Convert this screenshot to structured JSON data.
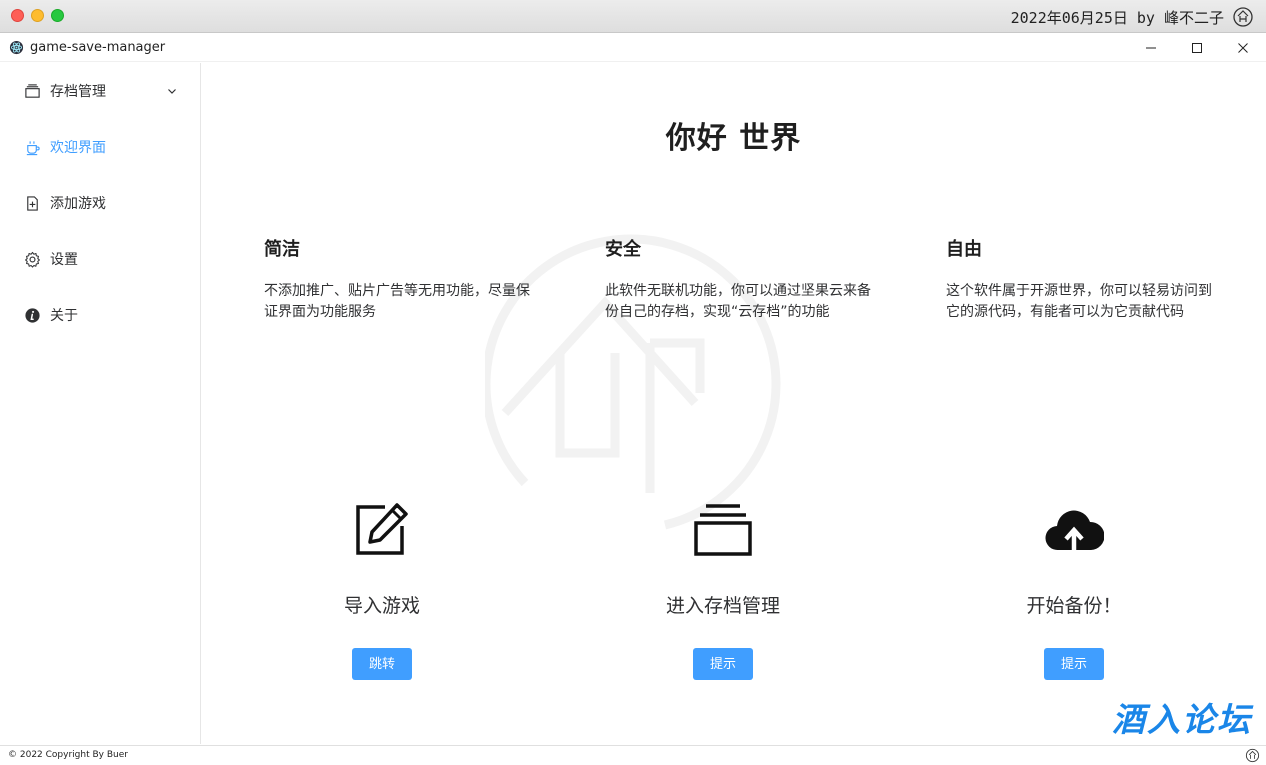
{
  "mac_bar": {
    "datetime": "2022年06月25日 by 峰不二子"
  },
  "window": {
    "title": "game-save-manager"
  },
  "sidebar": {
    "items": [
      {
        "label": "存档管理",
        "icon": "archive-icon",
        "expandable": true
      },
      {
        "label": "欢迎界面",
        "icon": "coffee-cup-icon",
        "active": true
      },
      {
        "label": "添加游戏",
        "icon": "document-add-icon"
      },
      {
        "label": "设置",
        "icon": "gear-icon"
      },
      {
        "label": "关于",
        "icon": "info-icon"
      }
    ]
  },
  "main": {
    "title": "你好 世界",
    "features": [
      {
        "title": "简洁",
        "text": "不添加推广、贴片广告等无用功能，尽量保证界面为功能服务"
      },
      {
        "title": "安全",
        "text": "此软件无联机功能，你可以通过坚果云来备份自己的存档，实现“云存档”的功能"
      },
      {
        "title": "自由",
        "text": "这个软件属于开源世界，你可以轻易访问到它的源代码，有能者可以为它贡献代码"
      }
    ],
    "actions": [
      {
        "label": "导入游戏",
        "button": "跳转",
        "icon": "edit-icon"
      },
      {
        "label": "进入存档管理",
        "button": "提示",
        "icon": "archive-stack-icon"
      },
      {
        "label": "开始备份！",
        "button": "提示",
        "icon": "cloud-upload-icon"
      }
    ],
    "forum_logo": "酒入论坛"
  },
  "footer": {
    "copyright": "© 2022 Copyright By Buer"
  },
  "colors": {
    "accent": "#409eff",
    "forum_blue": "#1a86e8"
  }
}
